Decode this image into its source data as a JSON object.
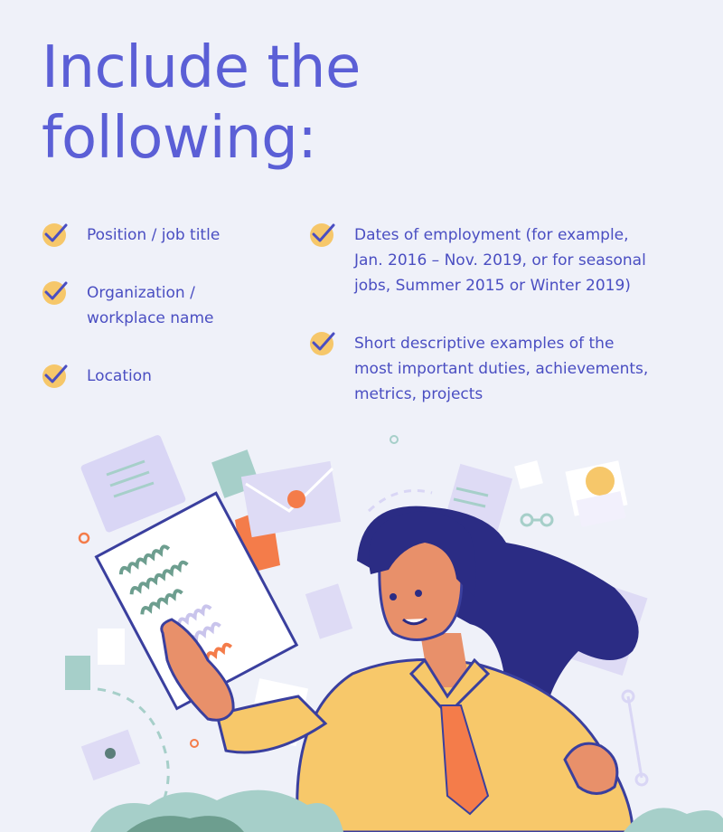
{
  "title_lines": [
    "Include the",
    "following:"
  ],
  "left_items": [
    {
      "lines": [
        "Position / job title"
      ],
      "icon": "check-icon"
    },
    {
      "lines": [
        "Organization /",
        "workplace name"
      ],
      "icon": "check-icon"
    },
    {
      "lines": [
        "Location"
      ],
      "icon": "check-icon"
    }
  ],
  "right_items": [
    {
      "lines": [
        "Dates of employment (for example,",
        "Jan. 2016 – Nov. 2019, or for seasonal",
        "jobs, Summer 2015 or Winter 2019)"
      ],
      "icon": "check-icon"
    },
    {
      "lines": [
        "Short descriptive examples of the",
        "most important duties, achievements,",
        "metrics, projects"
      ],
      "icon": "check-icon"
    }
  ],
  "colors": {
    "accent": "#5b5fd6",
    "check_circle": "#f6c76a",
    "background": "#eff1f9"
  }
}
